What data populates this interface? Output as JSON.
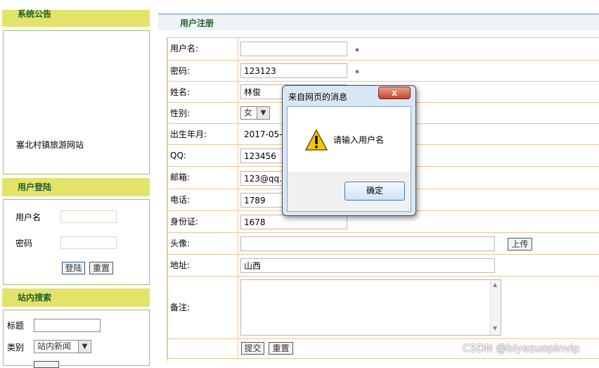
{
  "sidebar": {
    "announce": {
      "title": "系统公告",
      "content": "塞北村镇旅游网站"
    },
    "login": {
      "title": "用户登陆",
      "username_label": "用户名",
      "password_label": "密码",
      "login_button": "登陆",
      "reset_button": "重置"
    },
    "search": {
      "title": "站内搜索",
      "title_label": "标题",
      "category_label": "类别",
      "category_value": "站内新闻"
    }
  },
  "main": {
    "title": "用户注册",
    "fields": {
      "username": {
        "label": "用户名:",
        "value": ""
      },
      "password": {
        "label": "密码:",
        "value": "123123"
      },
      "name": {
        "label": "姓名:",
        "value": "林俊"
      },
      "gender": {
        "label": "性别:",
        "value": "女"
      },
      "birth": {
        "label": "出生年月:",
        "value": "2017-05-"
      },
      "qq": {
        "label": "QQ:",
        "value": "123456"
      },
      "email": {
        "label": "邮箱:",
        "value": "123@qq.c"
      },
      "phone": {
        "label": "电话:",
        "value": "1789"
      },
      "idcard": {
        "label": "身份证:",
        "value": "1678"
      },
      "avatar": {
        "label": "头像:",
        "value": "",
        "upload_button": "上传"
      },
      "address": {
        "label": "地址:",
        "value": "山西"
      },
      "remark": {
        "label": "备注:",
        "value": ""
      }
    },
    "required_mark": "*",
    "submit_button": "提交",
    "reset_button": "重置"
  },
  "dialog": {
    "title": "来自网页的消息",
    "message": "请输入用户名",
    "ok_button": "确定",
    "close_glyph": "x"
  },
  "watermark": "CSDN @biyezuopinvip",
  "icons": [
    "warning-icon",
    "close-icon",
    "dropdown-arrow-icon",
    "scroll-up-icon",
    "scroll-down-icon"
  ]
}
